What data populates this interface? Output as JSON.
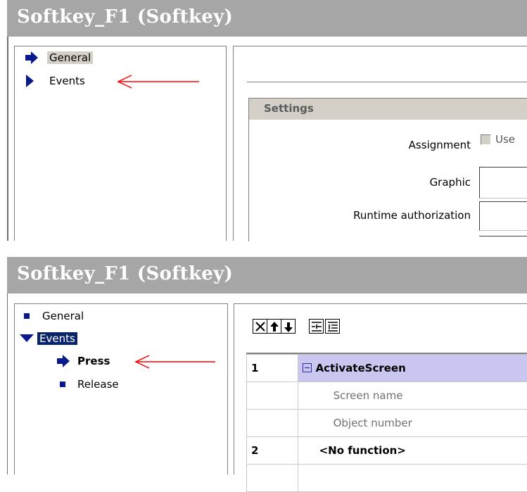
{
  "top_panel": {
    "title": "Softkey_F1 (Softkey)",
    "tree": [
      {
        "label": "General",
        "icon": "arrow-right-icon",
        "selected": true
      },
      {
        "label": "Events",
        "icon": "triangle-right-icon",
        "selected": false
      }
    ],
    "settings": {
      "heading": "Settings",
      "assignment_label": "Assignment",
      "assignment_checkbox_label": "Use",
      "graphic_label": "Graphic",
      "runtime_authorization_label": "Runtime authorization"
    }
  },
  "bottom_panel": {
    "title": "Softkey_F1 (Softkey)",
    "tree": [
      {
        "label": "General",
        "icon": "square-bullet-icon"
      },
      {
        "label": "Events",
        "icon": "triangle-down-icon",
        "selected": true
      },
      {
        "label": "Press",
        "icon": "arrow-right-icon",
        "bold": true
      },
      {
        "label": "Release",
        "icon": "square-bullet-icon"
      }
    ],
    "toolbar": [
      {
        "name": "delete-button",
        "icon": "x-icon"
      },
      {
        "name": "move-up-button",
        "icon": "arrow-up-icon"
      },
      {
        "name": "move-down-button",
        "icon": "arrow-down-icon"
      },
      {
        "name": "indent-button",
        "icon": "indent-icon"
      },
      {
        "name": "list-button",
        "icon": "list-icon"
      }
    ],
    "function_list": [
      {
        "num": "1",
        "label": "ActivateScreen",
        "kind": "function",
        "expanded": true
      },
      {
        "num": "",
        "label": "Screen name",
        "kind": "parameter"
      },
      {
        "num": "",
        "label": "Object number",
        "kind": "parameter"
      },
      {
        "num": "2",
        "label": "<No function>",
        "kind": "empty"
      }
    ]
  },
  "colors": {
    "title_bar": "#a6a6a6",
    "selection_blue": "#0a246a",
    "icon_blue": "#0a1a8c",
    "active_row": "#c9c6f0",
    "annotation_red": "#ff0000"
  }
}
